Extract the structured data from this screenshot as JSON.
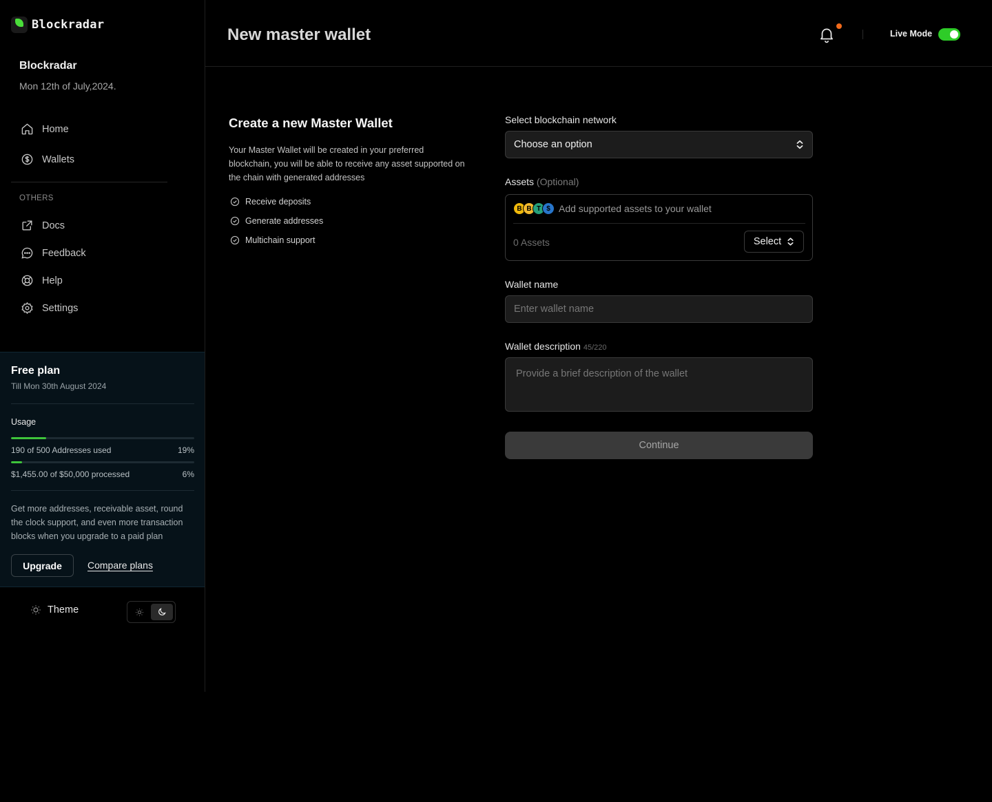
{
  "brand": {
    "name": "Blockradar",
    "accent": "#3ec43b"
  },
  "org": {
    "name": "Blockradar",
    "date": "Mon 12th of July,2024."
  },
  "nav": {
    "main": [
      {
        "label": "Home",
        "icon": "home-icon"
      },
      {
        "label": "Wallets",
        "icon": "dollar-circle-icon"
      }
    ],
    "section_label": "OTHERS",
    "others": [
      {
        "label": "Docs",
        "icon": "external-link-icon"
      },
      {
        "label": "Feedback",
        "icon": "chat-bubble-icon"
      },
      {
        "label": "Help",
        "icon": "lifebuoy-icon"
      },
      {
        "label": "Settings",
        "icon": "gear-icon"
      }
    ]
  },
  "plan": {
    "title": "Free plan",
    "subtitle": "Till Mon 30th August 2024",
    "usage_label": "Usage",
    "addresses": {
      "text": "190 of 500 Addresses used",
      "percent_label": "19%",
      "fraction": 0.19
    },
    "processed": {
      "text": "$1,455.00 of $50,000 processed",
      "percent_label": "6%",
      "fraction": 0.06
    },
    "description": "Get more addresses, receivable asset, round the clock support, and even more transaction blocks when you upgrade to a paid plan",
    "upgrade_label": "Upgrade",
    "compare_label": "Compare plans"
  },
  "theme": {
    "label": "Theme",
    "active": "dark"
  },
  "header": {
    "title": "New master wallet",
    "live_mode_label": "Live Mode",
    "live_mode_on": true,
    "notification_dot_color": "#f26a1b"
  },
  "intro": {
    "title": "Create a new Master Wallet",
    "description": "Your Master Wallet will be created in your preferred blockchain, you will be able to receive any asset supported on the chain with generated addresses",
    "features": [
      "Receive deposits",
      "Generate addresses",
      "Multichain support"
    ]
  },
  "form": {
    "network": {
      "label": "Select blockchain network",
      "value": "Choose an option"
    },
    "assets": {
      "label": "Assets",
      "optional": "(Optional)",
      "prompt": "Add supported assets to your wallet",
      "count": "0 Assets",
      "select_label": "Select",
      "coins": [
        {
          "symbol": "B",
          "color": "#f0b90b"
        },
        {
          "symbol": "B",
          "color": "#f3ba2f"
        },
        {
          "symbol": "T",
          "color": "#26a17b"
        },
        {
          "symbol": "$",
          "color": "#2775ca"
        }
      ]
    },
    "wallet_name": {
      "label": "Wallet name",
      "placeholder": "Enter wallet name",
      "value": ""
    },
    "wallet_description": {
      "label": "Wallet description",
      "counter": "45/220",
      "placeholder": "Provide a brief description of the wallet",
      "value": ""
    },
    "continue_label": "Continue"
  }
}
